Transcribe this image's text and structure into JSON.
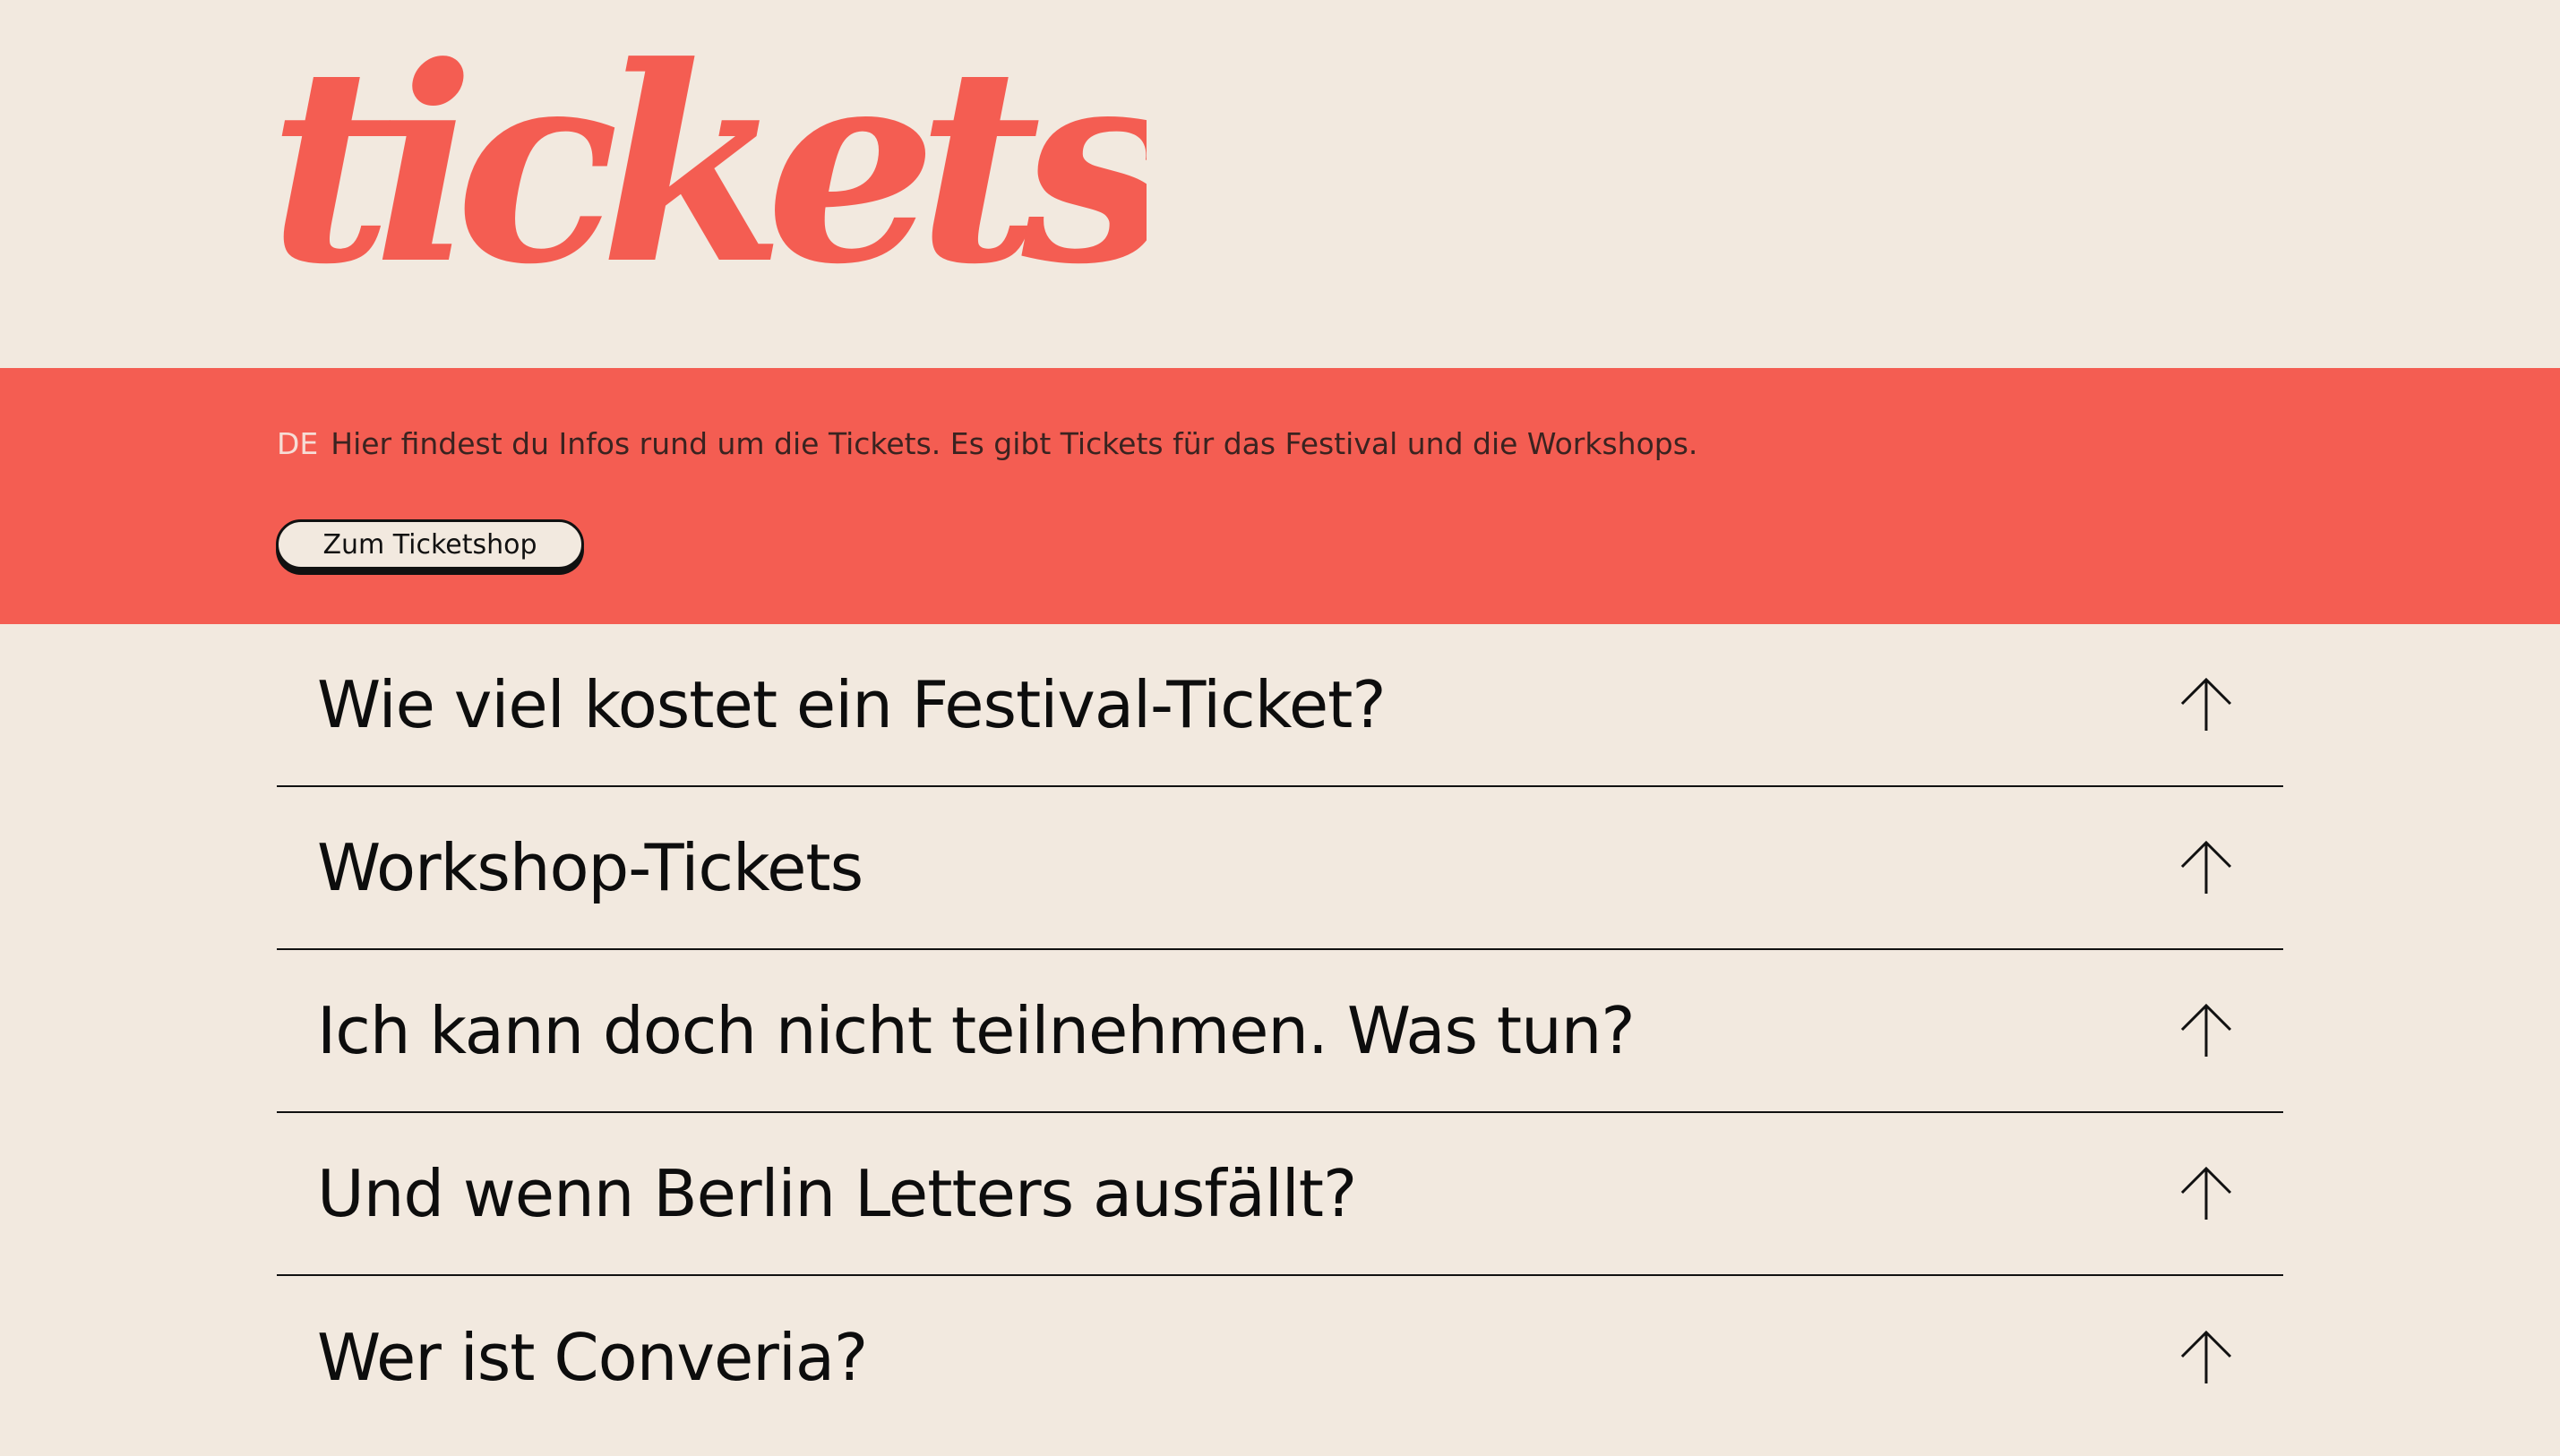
{
  "header": {
    "logo_text": "tickets",
    "logo_color": "#f45d52"
  },
  "intro": {
    "lang": "DE",
    "text": "Hier findest du Infos rund um die Tickets. Es gibt Tickets für das Festival und die Workshops.",
    "button_label": "Zum Ticketshop",
    "band_color": "#f45d52"
  },
  "faq": {
    "items": [
      {
        "question": "Wie viel kostet ein Festival-Ticket?",
        "icon": "arrow-up-icon"
      },
      {
        "question": "Workshop-Tickets",
        "icon": "arrow-up-icon"
      },
      {
        "question": "Ich kann doch nicht teilnehmen. Was tun?",
        "icon": "arrow-up-icon"
      },
      {
        "question": "Und wenn Berlin Letters ausfällt?",
        "icon": "arrow-up-icon"
      },
      {
        "question": "Wer ist Converia?",
        "icon": "arrow-up-icon"
      }
    ]
  },
  "colors": {
    "background": "#f2e9df",
    "text": "#111111"
  }
}
